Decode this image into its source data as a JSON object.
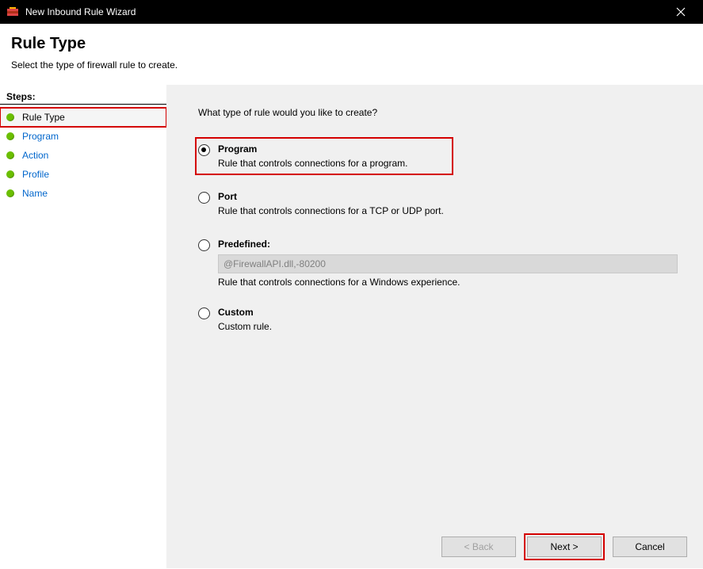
{
  "window": {
    "title": "New Inbound Rule Wizard"
  },
  "header": {
    "title": "Rule Type",
    "subtitle": "Select the type of firewall rule to create."
  },
  "sidebar": {
    "heading": "Steps:",
    "items": [
      {
        "label": "Rule Type",
        "current": true
      },
      {
        "label": "Program"
      },
      {
        "label": "Action"
      },
      {
        "label": "Profile"
      },
      {
        "label": "Name"
      }
    ]
  },
  "main": {
    "prompt": "What type of rule would you like to create?",
    "options": {
      "program": {
        "title": "Program",
        "desc": "Rule that controls connections for a program."
      },
      "port": {
        "title": "Port",
        "desc": "Rule that controls connections for a TCP or UDP port."
      },
      "predefined": {
        "title": "Predefined:",
        "value": "@FirewallAPI.dll,-80200",
        "desc": "Rule that controls connections for a Windows experience."
      },
      "custom": {
        "title": "Custom",
        "desc": "Custom rule."
      }
    }
  },
  "buttons": {
    "back": "< Back",
    "next": "Next >",
    "cancel": "Cancel"
  }
}
